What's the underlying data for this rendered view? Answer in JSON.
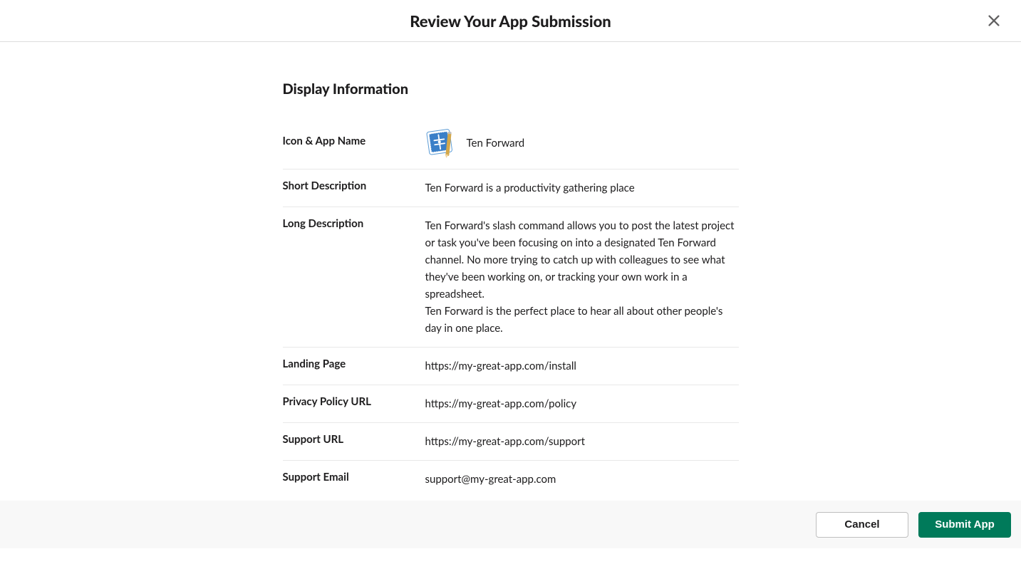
{
  "header": {
    "title": "Review Your App Submission"
  },
  "section": {
    "title": "Display Information"
  },
  "fields": {
    "iconAppName": {
      "label": "Icon & App Name",
      "value": "Ten Forward"
    },
    "shortDescription": {
      "label": "Short Description",
      "value": "Ten Forward is a productivity gathering place"
    },
    "longDescription": {
      "label": "Long Description",
      "p1": "Ten Forward's slash command allows you to post the latest project or task you've been focusing on into a designated Ten Forward channel. No more trying to catch up with colleagues to see what they've been working on, or tracking your own work in a spreadsheet.",
      "p2": "Ten Forward is the perfect place to hear all about other people's day in one place."
    },
    "landingPage": {
      "label": "Landing Page",
      "value": "https://my-great-app.com/install"
    },
    "privacyPolicy": {
      "label": "Privacy Policy URL",
      "value": "https://my-great-app.com/policy"
    },
    "supportUrl": {
      "label": "Support URL",
      "value": "https://my-great-app.com/support"
    },
    "supportEmail": {
      "label": "Support Email",
      "value": "support@my-great-app.com"
    }
  },
  "footer": {
    "cancel": "Cancel",
    "submit": "Submit App"
  }
}
